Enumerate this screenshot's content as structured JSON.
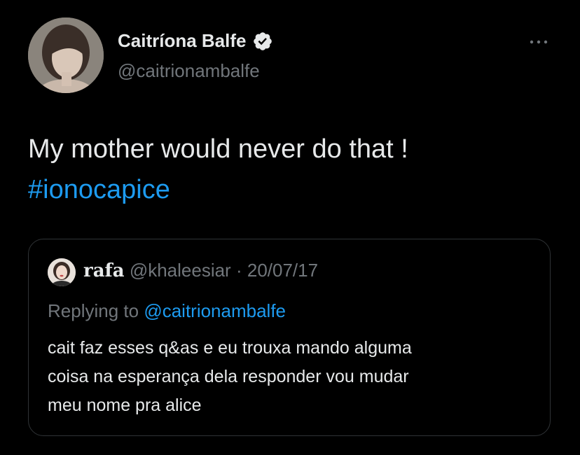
{
  "author": {
    "display_name": "Caitríona Balfe",
    "handle": "@caitrionambalfe",
    "verified": true,
    "avatar_icon": "profile-photo-avatar"
  },
  "menu_icon": "more-horizontal-icon",
  "tweet": {
    "text_line1": "My mother would never do that !",
    "hashtag": "#ionocapice"
  },
  "quote": {
    "name": "rafa",
    "handle": "@khaleesiar",
    "separator": "·",
    "date": "20/07/17",
    "replying_prefix": "Replying to",
    "replying_handle": "@caitrionambalfe",
    "text_lines": [
      "cait faz esses q&as e eu trouxa mando alguma",
      "coisa na esperança dela responder vou mudar",
      "meu nome pra alice"
    ]
  },
  "colors": {
    "background": "#000000",
    "text": "#e7e9ea",
    "secondary": "#71767b",
    "accent": "#1d9bf0",
    "border": "#2f3336"
  }
}
